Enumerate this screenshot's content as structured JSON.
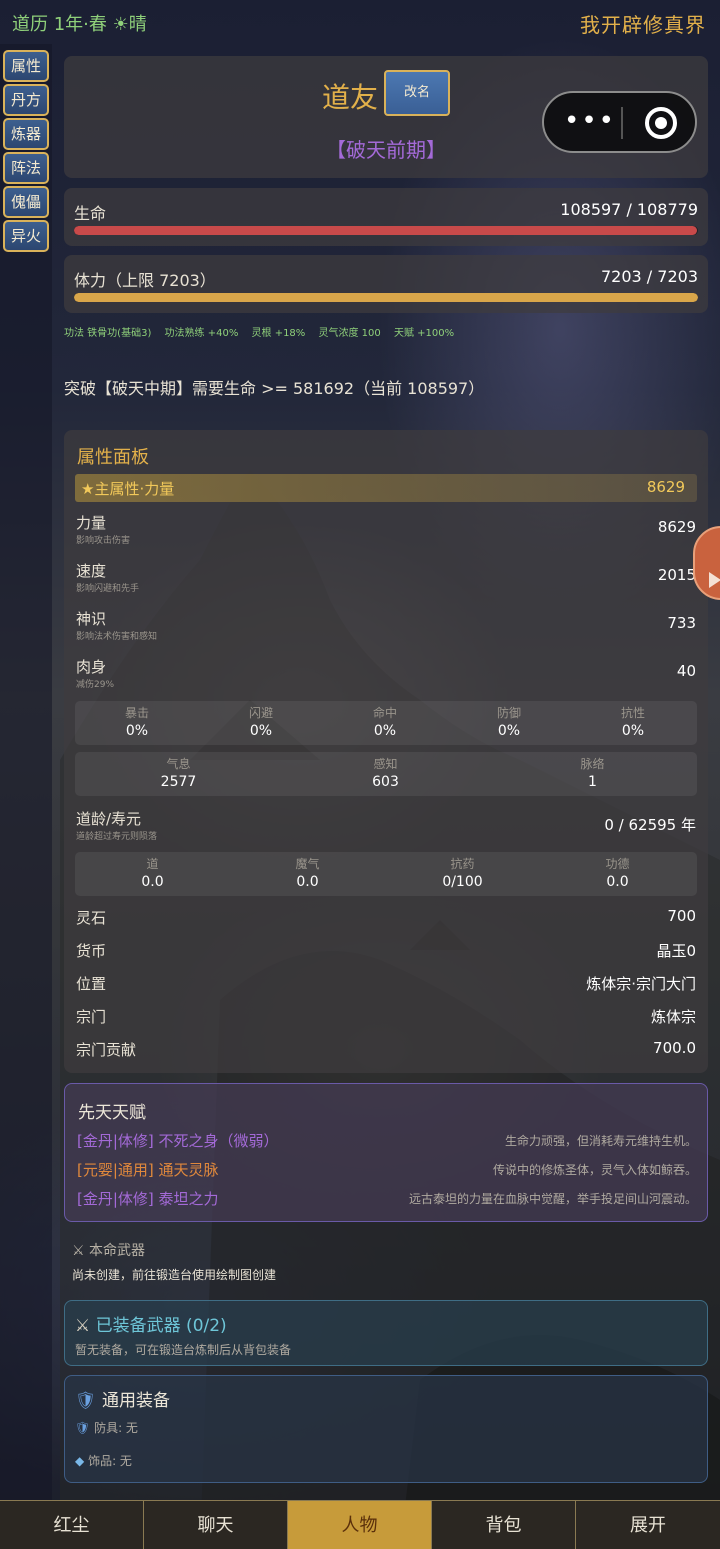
{
  "topbar": {
    "status": "道历 1年·春 ☀晴",
    "app_title": "我开辟修真界"
  },
  "sidebar": {
    "items": [
      {
        "label": "属性"
      },
      {
        "label": "丹方"
      },
      {
        "label": "炼器"
      },
      {
        "label": "阵法符"
      },
      {
        "label": "傀儡"
      },
      {
        "label": "异火"
      }
    ]
  },
  "profile": {
    "name": "道友",
    "rename_label": "改名",
    "realm": "【破天前期】"
  },
  "capsule": {
    "more": "•••",
    "close_icon": "target-ring-icon"
  },
  "life": {
    "label": "生命",
    "value": "108597 / 108779",
    "fraction": 0.998,
    "color": "#c84a4a"
  },
  "stamina": {
    "label": "体力（上限 7203）",
    "value": "7203 / 7203",
    "fraction": 1.0,
    "color": "#d9a64a"
  },
  "bonuses": [
    "功法 铁骨功(基础3)",
    "功法熟练 +40%",
    "灵根 +18%",
    "灵气浓度 100",
    "天赋 +100%"
  ],
  "breakthrough": "突破【破天中期】需要生命 >= 581692（当前 108597）",
  "attributes": {
    "title": "属性面板",
    "main": {
      "label": "★主属性·力量",
      "value": "8629"
    },
    "rows": [
      {
        "label": "力量",
        "sub": "影响攻击伤害",
        "value": "8629"
      },
      {
        "label": "速度",
        "sub": "影响闪避和先手",
        "value": "2015"
      },
      {
        "label": "神识",
        "sub": "影响法术伤害和感知",
        "value": "733"
      },
      {
        "label": "肉身",
        "sub": "减伤29%",
        "value": "40"
      }
    ],
    "combat": [
      {
        "label": "暴击",
        "value": "0%"
      },
      {
        "label": "闪避",
        "value": "0%"
      },
      {
        "label": "命中",
        "value": "0%"
      },
      {
        "label": "防御",
        "value": "0%"
      },
      {
        "label": "抗性",
        "value": "0%"
      }
    ],
    "inner": [
      {
        "label": "气息",
        "value": "2577"
      },
      {
        "label": "感知",
        "value": "603"
      },
      {
        "label": "脉络",
        "value": "1"
      }
    ],
    "lifespan": {
      "label": "道龄/寿元",
      "sub": "道龄超过寿元则陨落",
      "value": "0 / 62595 年"
    },
    "dao": [
      {
        "label": "道",
        "value": "0.0"
      },
      {
        "label": "魔气",
        "value": "0.0"
      },
      {
        "label": "抗药",
        "value": "0/100"
      },
      {
        "label": "功德",
        "value": "0.0"
      }
    ],
    "misc": [
      {
        "label": "灵石",
        "value": "700"
      },
      {
        "label": "货币",
        "value": "晶玉0"
      },
      {
        "label": "位置",
        "value": "炼体宗·宗门大门"
      },
      {
        "label": "宗门",
        "value": "炼体宗"
      },
      {
        "label": "宗门贡献",
        "value": "700.0"
      }
    ]
  },
  "talents": {
    "title": "先天天赋",
    "items": [
      {
        "tag": "[金丹|体修] 不死之身（微弱）",
        "desc": "生命力顽强，但消耗寿元维持生机。",
        "color": "#a46ad8"
      },
      {
        "tag": "[元婴|通用] 通天灵脉",
        "desc": "传说中的修炼圣体，灵气入体如鲸吞。",
        "color": "#e0883c"
      },
      {
        "tag": "[金丹|体修] 泰坦之力",
        "desc": "远古泰坦的力量在血脉中觉醒，举手投足间山河震动。",
        "color": "#a46ad8"
      }
    ]
  },
  "natal_weapon": {
    "title": "本命武器",
    "desc": "尚未创建，前往锻造台使用绘制图创建"
  },
  "equipped_weapons": {
    "title": "已装备武器 (0/2)",
    "desc": "暂无装备，可在锻造台炼制后从背包装备"
  },
  "gear": {
    "title": "通用装备",
    "armor": "防具: 无",
    "accessory": "饰品: 无"
  },
  "tabs": [
    {
      "label": "红尘"
    },
    {
      "label": "聊天"
    },
    {
      "label": "人物",
      "active": true
    },
    {
      "label": "背包"
    },
    {
      "label": "展开"
    }
  ]
}
